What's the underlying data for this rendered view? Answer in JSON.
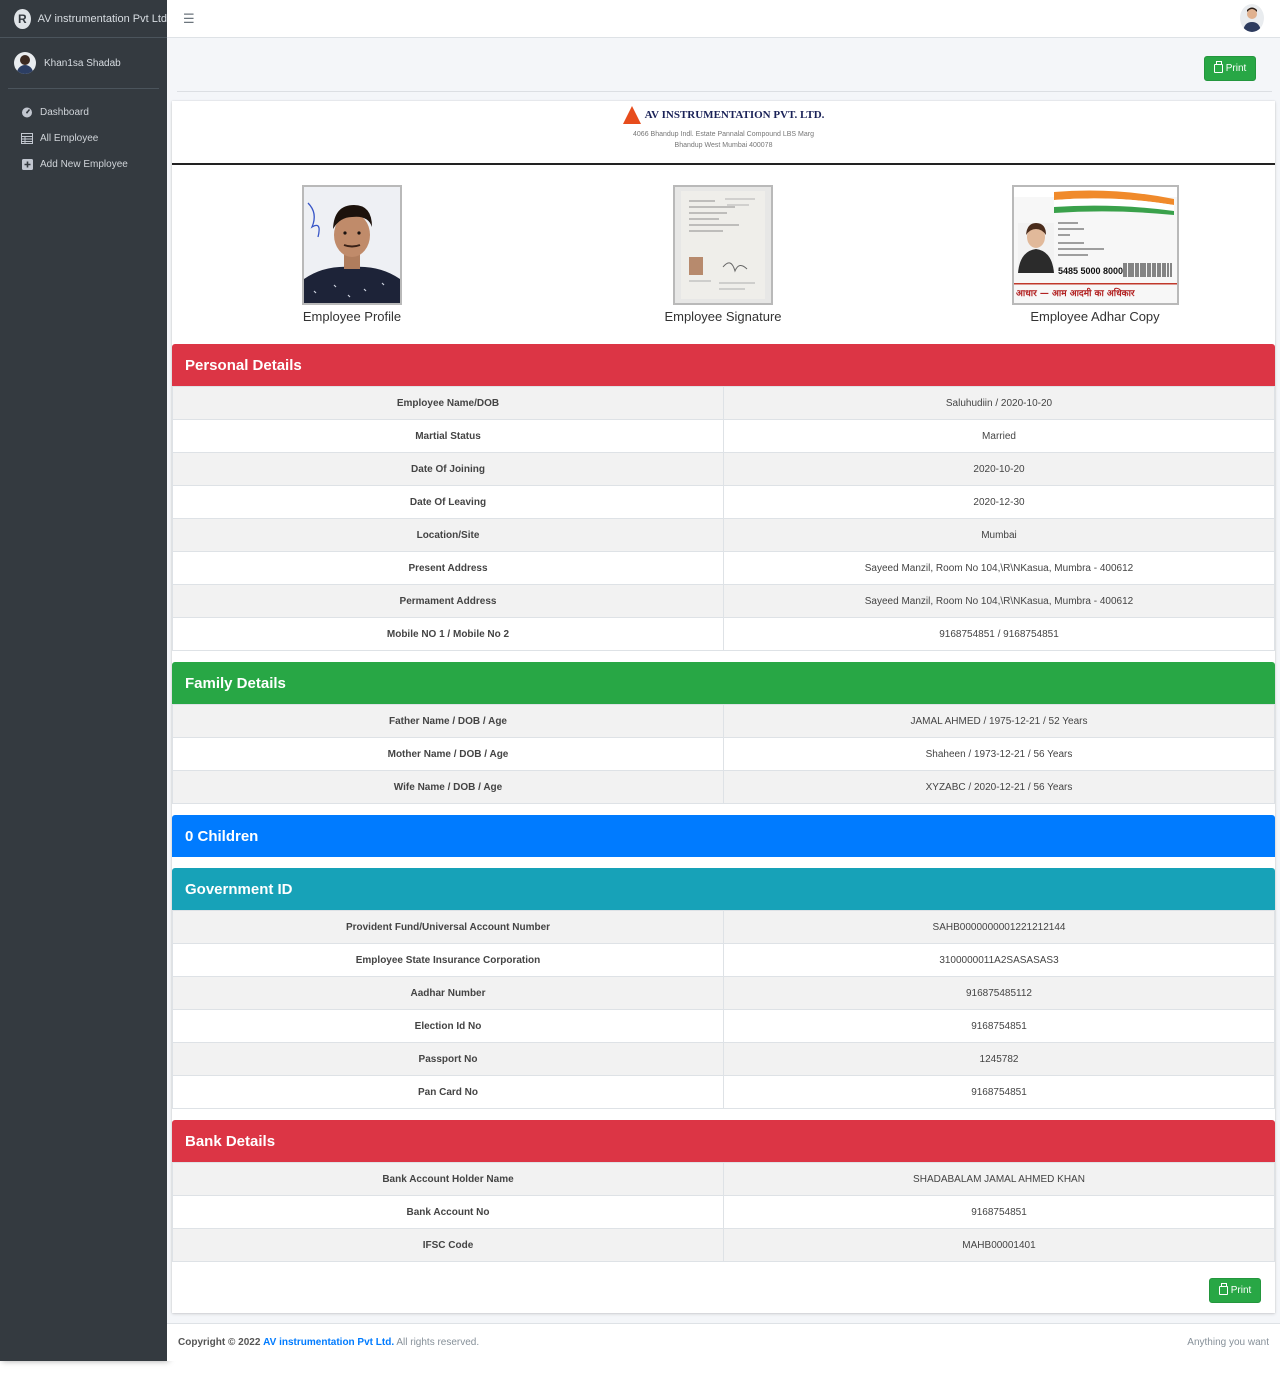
{
  "brand": {
    "name": "AV instrumentation Pvt Ltd",
    "logo_letter": "R"
  },
  "user": {
    "name": "Khan1sa Shadab"
  },
  "sidebar": {
    "items": [
      {
        "label": "Dashboard",
        "icon": "tachometer-icon"
      },
      {
        "label": "All Employee",
        "icon": "table-icon"
      },
      {
        "label": "Add New Employee",
        "icon": "plus-square-icon"
      }
    ]
  },
  "actions": {
    "print_label": "Print"
  },
  "letterhead": {
    "company": "AV INSTRUMENTATION PVT. LTD.",
    "address_line1": "4066 Bhandup Indl. Estate Pannalal Compound LBS Marg",
    "address_line2": "Bhandup West Mumbai 400078"
  },
  "photos": {
    "profile": "Employee Profile",
    "signature": "Employee Signature",
    "adhar": "Employee Adhar Copy",
    "adhar_number": "5485 5000 8000",
    "adhar_tagline": "आधार — आम आदमी का अधिकार"
  },
  "personal": {
    "title": "Personal Details",
    "rows": [
      {
        "label": "Employee Name/DOB",
        "value": "Saluhudiin / 2020-10-20"
      },
      {
        "label": "Martial Status",
        "value": "Married"
      },
      {
        "label": "Date Of Joining",
        "value": "2020-10-20"
      },
      {
        "label": "Date Of Leaving",
        "value": "2020-12-30"
      },
      {
        "label": "Location/Site",
        "value": "Mumbai"
      },
      {
        "label": "Present Address",
        "value": "Sayeed Manzil, Room No 104,\\R\\NKasua, Mumbra - 400612"
      },
      {
        "label": "Permament Address",
        "value": "Sayeed Manzil, Room No 104,\\R\\NKasua, Mumbra - 400612"
      },
      {
        "label": "Mobile NO 1 / Mobile No 2",
        "value": "9168754851 / 9168754851"
      }
    ]
  },
  "family": {
    "title": "Family Details",
    "rows": [
      {
        "label": "Father Name / DOB / Age",
        "value": "JAMAL AHMED / 1975-12-21 / 52 Years"
      },
      {
        "label": "Mother Name / DOB / Age",
        "value": "Shaheen / 1973-12-21 / 56 Years"
      },
      {
        "label": "Wife Name / DOB / Age",
        "value": "XYZABC / 2020-12-21 / 56 Years"
      }
    ]
  },
  "children": {
    "title": "0 Children"
  },
  "govt": {
    "title": "Government ID",
    "rows": [
      {
        "label": "Provident Fund/Universal Account Number",
        "value": "SAHB0000000001221212144"
      },
      {
        "label": "Employee State Insurance Corporation",
        "value": "3100000011A2SASASAS3"
      },
      {
        "label": "Aadhar Number",
        "value": "916875485112"
      },
      {
        "label": "Election Id No",
        "value": "9168754851"
      },
      {
        "label": "Passport No",
        "value": "1245782"
      },
      {
        "label": "Pan Card No",
        "value": "9168754851"
      }
    ]
  },
  "bank": {
    "title": "Bank Details",
    "rows": [
      {
        "label": "Bank Account Holder Name",
        "value": "SHADABALAM JAMAL AHMED KHAN"
      },
      {
        "label": "Bank Account No",
        "value": "9168754851"
      },
      {
        "label": "IFSC Code",
        "value": "MAHB00001401"
      }
    ]
  },
  "footer": {
    "copyright": "Copyright © 2022",
    "company_link": "AV instrumentation Pvt Ltd.",
    "rights": "All rights reserved.",
    "right_text": "Anything you want"
  },
  "colors": {
    "personal": "#dc3545",
    "family": "#28a745",
    "children": "#007bff",
    "govt": "#17a2b8",
    "bank": "#dc3545",
    "sidebar": "#343a40"
  }
}
